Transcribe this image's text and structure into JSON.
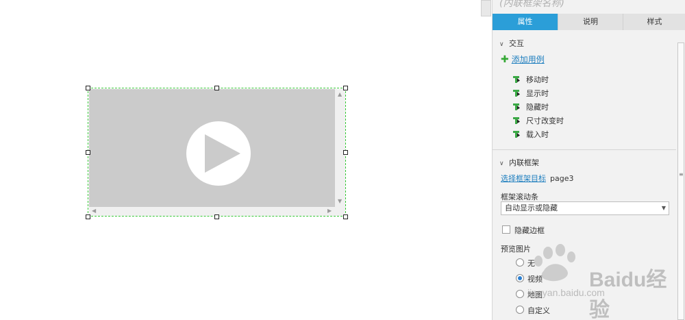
{
  "panel": {
    "title": "(内联框架名称)",
    "tabs": [
      {
        "label": "属性",
        "active": true
      },
      {
        "label": "说明",
        "active": false
      },
      {
        "label": "样式",
        "active": false
      }
    ]
  },
  "interaction": {
    "section_label": "交互",
    "add_case_label": "添加用例",
    "events": [
      "移动时",
      "显示时",
      "隐藏时",
      "尺寸改变时",
      "载入时"
    ]
  },
  "inline_frame": {
    "section_label": "内联框架",
    "target_link": "选择框架目标",
    "target_value": "page3",
    "scroll_label": "框架滚动条",
    "scroll_value": "自动显示或隐藏",
    "hide_border_label": "隐藏边框",
    "hide_border_checked": false,
    "preview_label": "预览图片",
    "preview_options": [
      {
        "label": "无",
        "selected": false
      },
      {
        "label": "视频",
        "selected": true
      },
      {
        "label": "地图",
        "selected": false
      },
      {
        "label": "自定义",
        "selected": false
      }
    ]
  },
  "watermark": {
    "text": "Baidu经验",
    "url": "jingyan.baidu.com"
  },
  "colors": {
    "accent": "#2b9ed8",
    "selection": "#35c835",
    "event_icon": "#3aa845",
    "link": "#1f7fbf",
    "frame_fill": "#cbcbcb"
  }
}
